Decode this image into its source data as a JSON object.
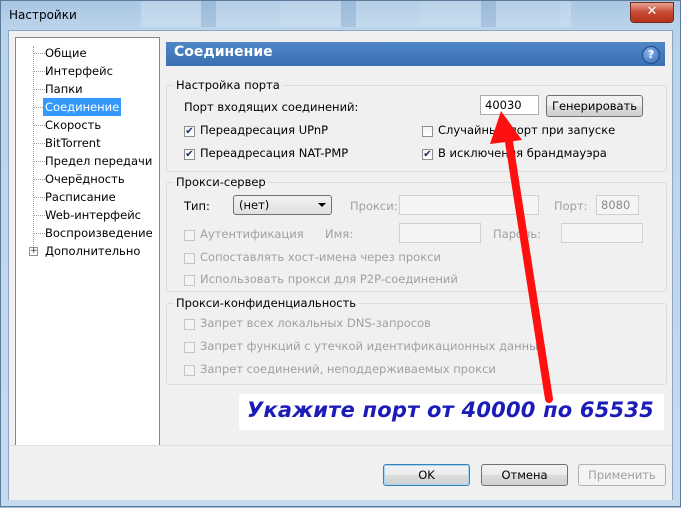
{
  "window": {
    "title": "Настройки",
    "close_icon": "close-icon",
    "close_glyph": "✕"
  },
  "tree": {
    "items": [
      {
        "label": "Общие"
      },
      {
        "label": "Интерфейс"
      },
      {
        "label": "Папки"
      },
      {
        "label": "Соединение",
        "selected": true
      },
      {
        "label": "Скорость"
      },
      {
        "label": "BitTorrent"
      },
      {
        "label": "Предел передачи"
      },
      {
        "label": "Очерёдность"
      },
      {
        "label": "Расписание"
      },
      {
        "label": "Web-интерфейс"
      },
      {
        "label": "Воспроизведение"
      },
      {
        "label": "Дополнительно",
        "expandable": true
      }
    ],
    "expander_glyph": "+"
  },
  "header": {
    "title": "Соединение",
    "help_glyph": "?"
  },
  "port_group": {
    "title": "Настройка порта",
    "port_label": "Порт входящих соединений:",
    "port_value": "40030",
    "generate_label": "Генерировать",
    "upnp_label": "Переадресация UPnP",
    "upnp_checked": true,
    "natpmp_label": "Переадресация NAT-PMP",
    "natpmp_checked": true,
    "random_port_label": "Случайный порт при запуске",
    "random_port_checked": false,
    "firewall_label": "В исключения брандмауэра",
    "firewall_checked": true,
    "check_glyph": "✔"
  },
  "proxy_group": {
    "title": "Прокси-сервер",
    "type_label": "Тип:",
    "type_value": "(нет)",
    "proxy_label": "Прокси:",
    "proxy_value": "",
    "port_label": "Порт:",
    "port_value": "8080",
    "auth_label": "Аутентификация",
    "name_label": "Имя:",
    "password_label": "Пароль:",
    "resolve_label": "Сопоставлять хост-имена через прокси",
    "p2p_label": "Использовать прокси для P2P-соединений"
  },
  "privacy_group": {
    "title": "Прокси-конфиденциальность",
    "dns_label": "Запрет всех локальных DNS-запросов",
    "leak_label": "Запрет функций с утечкой идентификационных данных",
    "unsupported_label": "Запрет соединений, неподдерживаемых прокси"
  },
  "annotation": {
    "text": "Укажите порт от 40000 по 65535",
    "color": "#1c1cb8",
    "arrow_color": "#ff1010"
  },
  "buttons": {
    "ok": "OK",
    "cancel": "Отмена",
    "apply": "Применить"
  }
}
